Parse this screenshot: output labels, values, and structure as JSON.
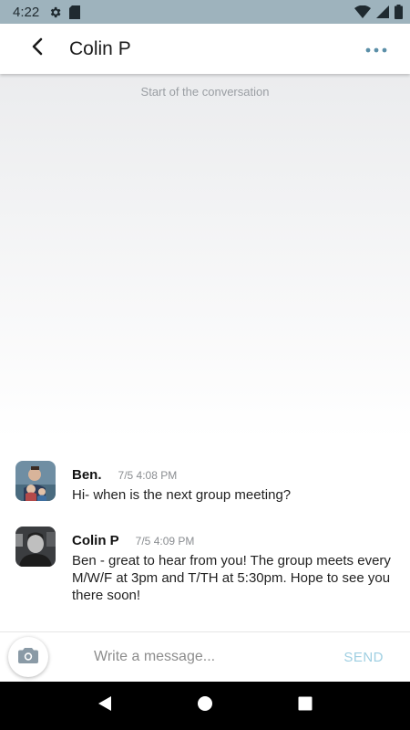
{
  "status_bar": {
    "time": "4:22",
    "icons": [
      "gear-icon",
      "sd-card-icon",
      "wifi-icon",
      "signal-icon",
      "battery-icon"
    ]
  },
  "header": {
    "title": "Colin P",
    "back_icon": "chevron-left-icon",
    "more_icon": "more-horizontal-icon",
    "accent_color": "#5b8fa8"
  },
  "conversation": {
    "start_text": "Start of the conversation",
    "messages": [
      {
        "sender": "Ben.",
        "time": "7/5 4:08 PM",
        "text": "Hi- when is the next group meeting?"
      },
      {
        "sender": "Colin P",
        "time": "7/5 4:09 PM",
        "text": "Ben - great to hear from you! The group meets every M/W/F at 3pm and T/TH at 5:30pm. Hope to see you there soon!"
      }
    ]
  },
  "composer": {
    "placeholder": "Write a message...",
    "send_label": "SEND",
    "camera_icon": "camera-icon",
    "send_color": "#9fcfe2"
  },
  "nav_bar": {
    "icons": [
      "back-triangle-icon",
      "home-circle-icon",
      "recents-square-icon"
    ]
  }
}
